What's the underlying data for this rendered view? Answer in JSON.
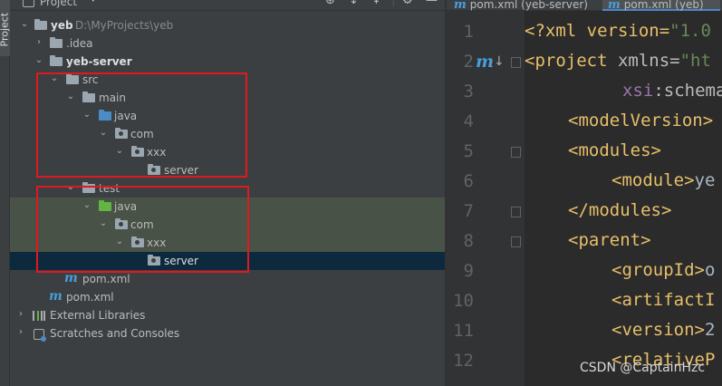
{
  "sidebar": {
    "label": "Project"
  },
  "panel": {
    "title": "Project"
  },
  "tree": {
    "root": {
      "name": "yeb",
      "path": "D:\\MyProjects\\yeb"
    },
    "idea": ".idea",
    "module": "yeb-server",
    "src": "src",
    "main": "main",
    "main_java": "java",
    "main_com": "com",
    "main_xxx": "xxx",
    "main_server": "server",
    "test": "test",
    "test_java": "java",
    "test_com": "com",
    "test_xxx": "xxx",
    "test_server": "server",
    "module_pom": "pom.xml",
    "root_pom": "pom.xml",
    "ext_libs": "External Libraries",
    "scratches": "Scratches and Consoles"
  },
  "editor": {
    "tabs": [
      {
        "label": "pom.xml (yeb-server)",
        "active": false
      },
      {
        "label": "pom.xml (yeb)",
        "active": true
      }
    ],
    "lines": [
      {
        "n": "1",
        "tag": "<?xml version=",
        "str": "\"1.0",
        "rest": ""
      },
      {
        "n": "2",
        "tag": "<project ",
        "attr": "xmlns=",
        "str": "\"ht"
      },
      {
        "n": "3",
        "ns": "xsi",
        "attr": ":schema"
      },
      {
        "n": "4",
        "tag": "<modelVersion>"
      },
      {
        "n": "5",
        "tag": "<modules>"
      },
      {
        "n": "6",
        "tag": "<module>",
        "txt": "ye"
      },
      {
        "n": "7",
        "tag": "</modules>"
      },
      {
        "n": "8",
        "tag": "<parent>"
      },
      {
        "n": "9",
        "tag": "<groupId>",
        "txt": "o"
      },
      {
        "n": "10",
        "tag": "<artifactI"
      },
      {
        "n": "11",
        "tag": "<version>",
        "txt": "2"
      },
      {
        "n": "12",
        "tag": "<relativeP"
      }
    ]
  },
  "watermark": "CSDN @CaptainHzc"
}
